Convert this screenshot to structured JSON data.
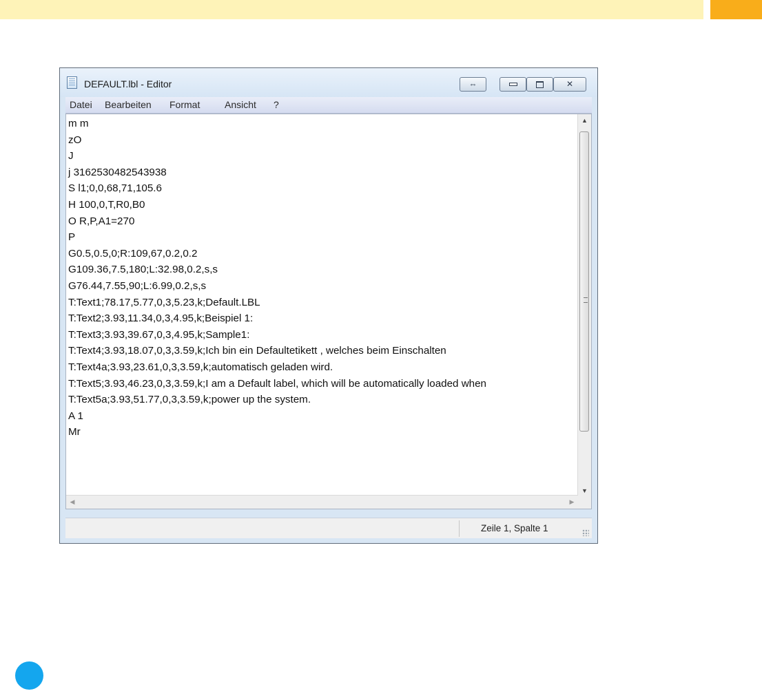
{
  "window": {
    "title": "DEFAULT.lbl - Editor",
    "buttons": {
      "aero_glyph": "⇔",
      "close_glyph": "✕"
    }
  },
  "menu": [
    "Datei",
    "Bearbeiten",
    "Format",
    "Ansicht",
    "?"
  ],
  "editor": {
    "lines": [
      "m m",
      "zO",
      "J",
      "j 3162530482543938",
      "S l1;0,0,68,71,105.6",
      "H 100,0,T,R0,B0",
      "O R,P,A1=270",
      "P",
      "G0.5,0.5,0;R:109,67,0.2,0.2",
      "G109.36,7.5,180;L:32.98,0.2,s,s",
      "G76.44,7.55,90;L:6.99,0.2,s,s",
      "T:Text1;78.17,5.77,0,3,5.23,k;Default.LBL",
      "T:Text2;3.93,11.34,0,3,4.95,k;Beispiel 1:",
      "T:Text3;3.93,39.67,0,3,4.95,k;Sample1:",
      "T:Text4;3.93,18.07,0,3,3.59,k;Ich bin ein Defaultetikett , welches beim Einschalten",
      "T:Text4a;3.93,23.61,0,3,3.59,k;automatisch geladen wird.",
      "T:Text5;3.93,46.23,0,3,3.59,k;I am a Default label, which will be automatically loaded when",
      "T:Text5a;3.93,51.77,0,3,3.59,k;power up the system.",
      "A 1",
      "Mr"
    ]
  },
  "statusbar": {
    "position": "Zeile 1, Spalte 1"
  },
  "colors": {
    "top_bar": "#fef3b8",
    "top_accent": "#f9ad1a",
    "blue_dot": "#14a6ee"
  }
}
